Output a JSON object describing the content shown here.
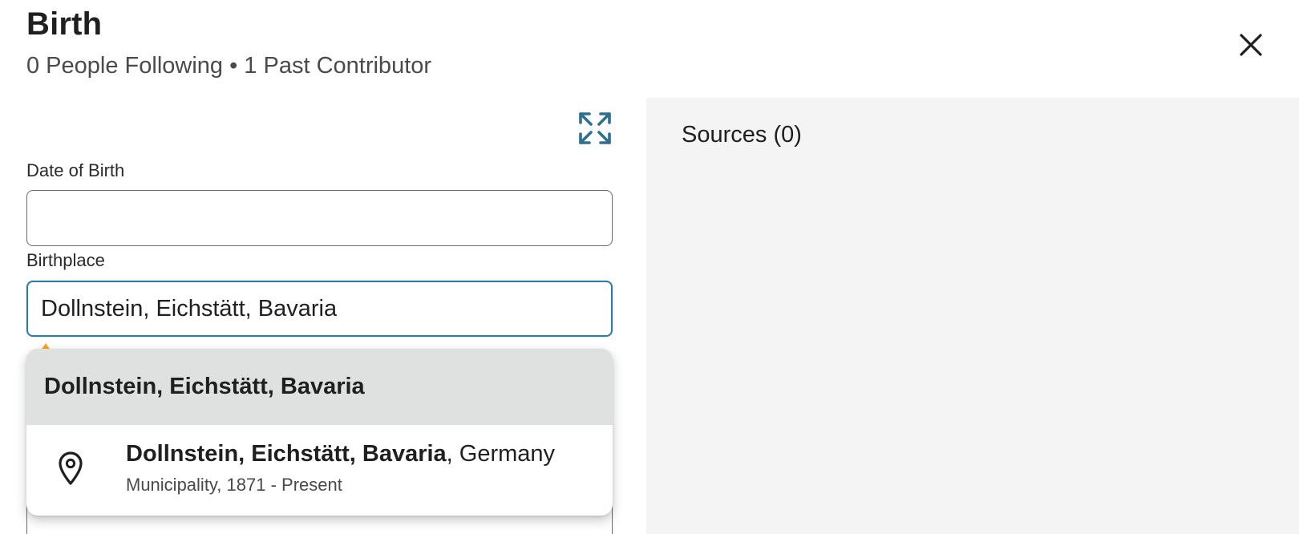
{
  "header": {
    "title": "Birth",
    "subtitle": "0 People Following • 1 Past Contributor",
    "close_icon": "close-icon"
  },
  "form": {
    "expand_icon": "expand-arrows-icon",
    "date_label": "Date of Birth",
    "date_value": "",
    "place_label": "Birthplace",
    "place_value": "Dollnstein, Eichstätt, Bavaria"
  },
  "dropdown": {
    "typed_option": "Dollnstein, Eichstätt, Bavaria",
    "suggestions": [
      {
        "icon": "location-pin-icon",
        "match_text": "Dollnstein, Eichstätt, Bavaria",
        "rest_text": ", Germany",
        "detail": "Municipality, 1871 - Present"
      }
    ]
  },
  "sources": {
    "title": "Sources (0)"
  },
  "colors": {
    "accent": "#2f7ea2",
    "panel_bg": "#f4f4f4",
    "highlight_bg": "#dfe0e0",
    "warning": "#f5a623"
  }
}
